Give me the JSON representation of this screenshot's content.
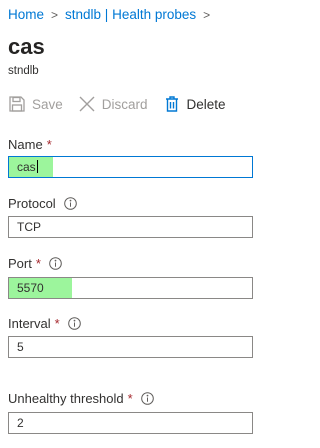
{
  "breadcrumb": [
    {
      "label": "Home"
    },
    {
      "label": "stndlb | Health probes"
    }
  ],
  "breadcrumb_separator": ">",
  "page": {
    "title": "cas",
    "subtitle": "stndlb"
  },
  "toolbar": {
    "save_label": "Save",
    "discard_label": "Discard",
    "delete_label": "Delete"
  },
  "form": {
    "name": {
      "label": "Name",
      "required_mark": "*",
      "value": "cas"
    },
    "protocol": {
      "label": "Protocol",
      "value": "TCP"
    },
    "port": {
      "label": "Port",
      "required_mark": "*",
      "value": "5570"
    },
    "interval": {
      "label": "Interval",
      "required_mark": "*",
      "value": "5"
    },
    "unhealthy_threshold": {
      "label": "Unhealthy threshold",
      "required_mark": "*",
      "value": "2"
    }
  },
  "colors": {
    "link": "#0078d4",
    "required": "#a4262c",
    "highlight": "#9cf59c",
    "disabled": "#a19f9d"
  },
  "icons": [
    "save-icon",
    "discard-icon",
    "delete-icon",
    "info-icon"
  ]
}
